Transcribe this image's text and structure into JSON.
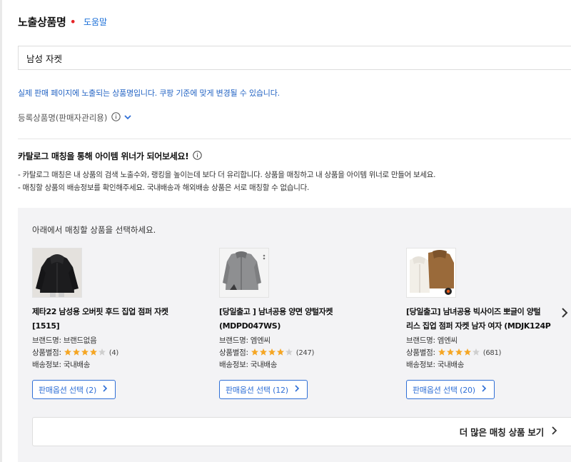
{
  "header": {
    "title": "노출상품명",
    "required_mark": "•",
    "help_link": "도움말"
  },
  "name_input": {
    "value": "남성 자켓"
  },
  "notice": "실제 판매 페이지에 노출되는 상품명입니다. 쿠팡 기준에 맞게 변경될 수 있습니다.",
  "registered_name": {
    "label": "등록상품명(판매자관리용)"
  },
  "catalog": {
    "title": "카탈로그 매칭을 통해 아이템 위너가 되어보세요!",
    "desc1": "- 카탈로그 매칭은 내 상품의 검색 노출수와, 랭킹을 높이는데 보다 더 유리합니다. 상품을 매칭하고 내 상품을 아이템 위너로 만들어 보세요.",
    "desc2": "- 매칭할 상품의 배송정보를 확인해주세요. 국내배송과 해외배송 상품은 서로 매칭할 수 없습니다."
  },
  "matching": {
    "prompt": "아래에서 매칭할 상품을 선택하세요.",
    "products": [
      {
        "name_line1": "제타22 남성용 오버핏 후드 집업 점퍼 자켓",
        "name_line2": "[1515]",
        "brand": "브랜드명: 브랜드없음",
        "rating_label": "상품별점:",
        "rating": 4,
        "reviews": "(4)",
        "shipping": "배송정보: 국내배송",
        "option_button": "판매옵션 선택 (2)",
        "image_icon": "black-fur-jacket-icon"
      },
      {
        "name_line1": "[당일출고 ] 남녀공용 양면 양털자켓",
        "name_line2": "(MDPD047WS)",
        "brand": "브랜드명: 엠엔씨",
        "rating_label": "상품별점:",
        "rating": 4,
        "reviews": "(247)",
        "shipping": "배송정보: 국내배송",
        "option_button": "판매옵션 선택 (12)",
        "image_icon": "gray-fleece-jacket-icon"
      },
      {
        "name_line1": "[당일출고] 남녀공용 빅사이즈 뽀글이 양털",
        "name_line2": "리스 집업 점퍼 자켓 남자 여자 (MDJK124P",
        "brand": "브랜드명: 엠엔씨",
        "rating_label": "상품별점:",
        "rating": 4,
        "reviews": "(681)",
        "shipping": "배송정보: 국내배송",
        "option_button": "판매옵션 선택 (20)",
        "image_icon": "brown-white-fleece-jacket-icon"
      }
    ],
    "more_button": "더 많은 매칭 상품 보기"
  },
  "colors": {
    "accent": "#2f6fd6",
    "link": "#1b6fd8",
    "required": "#e52528",
    "star": "#f5a623",
    "star_empty": "#cfcfcf"
  }
}
